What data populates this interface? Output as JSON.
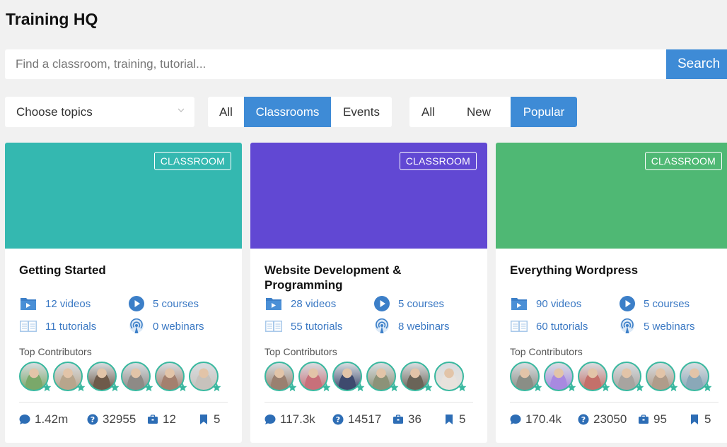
{
  "page": {
    "title": "Training HQ"
  },
  "search": {
    "placeholder": "Find a classroom, training, tutorial...",
    "button_label": "Search"
  },
  "filters": {
    "topics_placeholder": "Choose topics",
    "type_tabs": [
      {
        "label": "All",
        "active": false
      },
      {
        "label": "Classrooms",
        "active": true
      },
      {
        "label": "Events",
        "active": false
      }
    ],
    "sort_tabs": [
      {
        "label": "All",
        "active": false
      },
      {
        "label": "New",
        "active": false
      },
      {
        "label": "Popular",
        "active": true
      }
    ]
  },
  "cards": [
    {
      "badge": "CLASSROOM",
      "title": "Getting Started",
      "banner_color": "#34b8b0",
      "videos": "12 videos",
      "courses": "5 courses",
      "tutorials": "11 tutorials",
      "webinars": "0 webinars",
      "contributors_label": "Top Contributors",
      "contributor_count": 6,
      "comments": "1.42m",
      "questions": "32955",
      "briefcase": "12",
      "bookmarks": "5"
    },
    {
      "badge": "CLASSROOM",
      "title": "Website Development & Programming",
      "banner_color": "#6148d3",
      "videos": "28 videos",
      "courses": "5 courses",
      "tutorials": "55 tutorials",
      "webinars": "8 webinars",
      "contributors_label": "Top Contributors",
      "contributor_count": 6,
      "comments": "117.3k",
      "questions": "14517",
      "briefcase": "36",
      "bookmarks": "5"
    },
    {
      "badge": "CLASSROOM",
      "title": "Everything Wordpress",
      "banner_color": "#4fb874",
      "videos": "90 videos",
      "courses": "5 courses",
      "tutorials": "60 tutorials",
      "webinars": "5 webinars",
      "contributors_label": "Top Contributors",
      "contributor_count": 6,
      "comments": "170.4k",
      "questions": "23050",
      "briefcase": "95",
      "bookmarks": "5"
    }
  ],
  "colors": {
    "accent": "#3e8bd6",
    "link": "#3a78c3",
    "avatar_ring": "#39b89f"
  }
}
